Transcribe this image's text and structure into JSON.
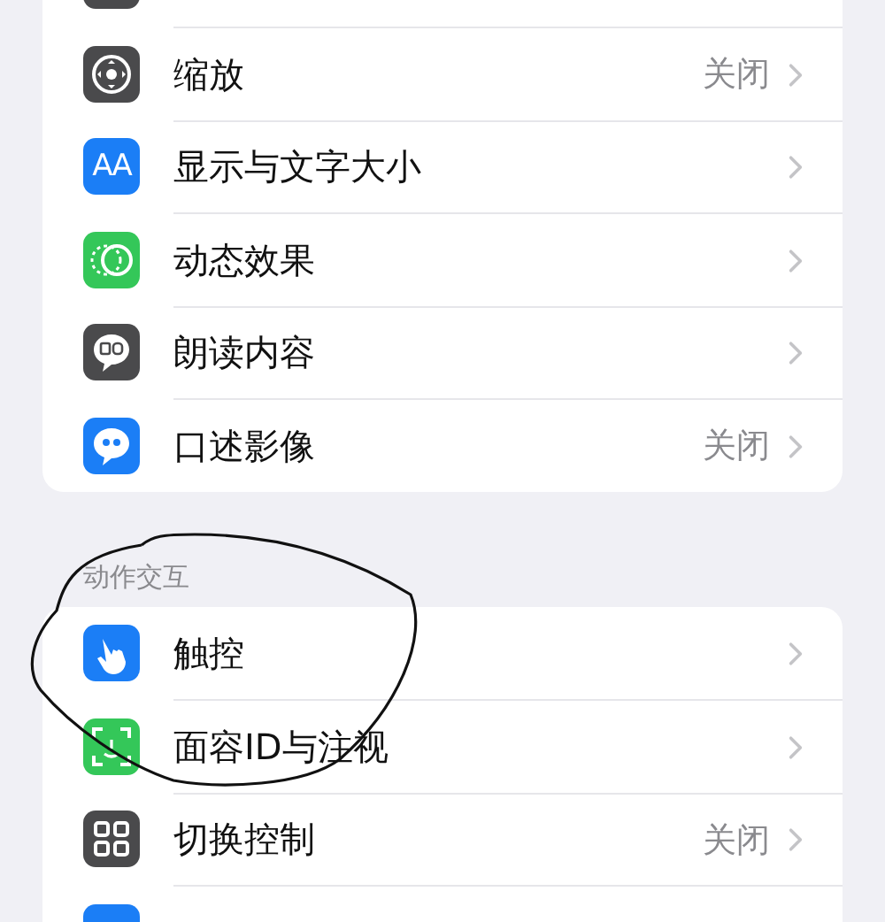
{
  "groups": [
    {
      "rows": [
        {
          "kind": "partial",
          "color": "#4a4a4c"
        },
        {
          "kind": "zoom",
          "color": "#4a4a4c",
          "label": "缩放",
          "value": "关闭"
        },
        {
          "kind": "text-size",
          "color": "#1b7ef6",
          "glyph": "AA",
          "label": "显示与文字大小"
        },
        {
          "kind": "motion",
          "color": "#34c759",
          "label": "动态效果"
        },
        {
          "kind": "speech",
          "color": "#4a4a4c",
          "label": "朗读内容"
        },
        {
          "kind": "quote",
          "color": "#1b7ef6",
          "label": "口述影像",
          "value": "关闭"
        }
      ]
    },
    {
      "header": "动作交互",
      "rows": [
        {
          "kind": "touch",
          "color": "#1b7ef6",
          "label": "触控"
        },
        {
          "kind": "face",
          "color": "#34c759",
          "label": "面容ID与注视"
        },
        {
          "kind": "grid",
          "color": "#4a4a4c",
          "label": "切换控制",
          "value": "关闭"
        },
        {
          "kind": "partial",
          "color": "#1b7ef6"
        }
      ]
    }
  ]
}
